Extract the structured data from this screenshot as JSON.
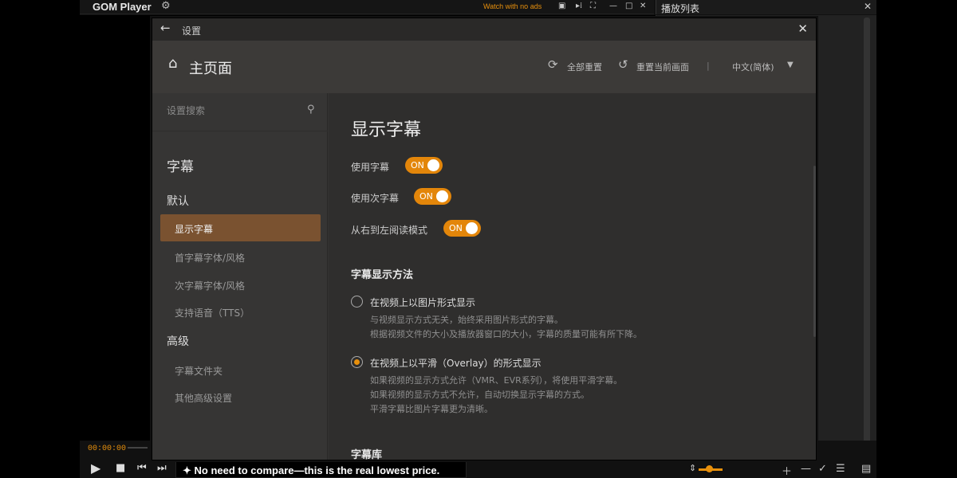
{
  "player": {
    "logo": "GOM Player",
    "ads_text": "Watch with no ads",
    "playlist_title": "播放列表",
    "time": "00:00:00",
    "ad_banner": "No need to compare—this is the real lowest price.",
    "volume_level": 0.3
  },
  "dialog": {
    "title": "设置",
    "home_title": "主页面",
    "reset_all": "全部重置",
    "reset_current": "重置当前画面",
    "separator": "|",
    "language": "中文(简体)"
  },
  "sidebar": {
    "search_placeholder": "设置搜索",
    "section_title": "字幕",
    "group_default": "默认",
    "items_default": [
      {
        "label": "显示字幕",
        "active": true
      },
      {
        "label": "首字幕字体/风格"
      },
      {
        "label": "次字幕字体/风格"
      },
      {
        "label": "支持语音（TTS）"
      }
    ],
    "group_advanced": "高级",
    "items_advanced": [
      {
        "label": "字幕文件夹"
      },
      {
        "label": "其他高级设置"
      }
    ]
  },
  "main": {
    "heading": "显示字幕",
    "toggles": [
      {
        "label": "使用字幕",
        "state": "ON"
      },
      {
        "label": "使用次字幕",
        "state": "ON"
      },
      {
        "label": "从右到左阅读模式",
        "state": "ON"
      }
    ],
    "method_title": "字幕显示方法",
    "option1": {
      "label": "在视频上以图片形式显示",
      "desc1": "与视频显示方式无关，始终采用图片形式的字幕。",
      "desc2": "根据视频文件的大小及播放器窗口的大小，字幕的质量可能有所下降。",
      "selected": false
    },
    "option2": {
      "label": "在视频上以平滑（Overlay）的形式显示",
      "desc1": "如果视频的显示方式允许（VMR、EVR系列），将使用平滑字幕。",
      "desc2": "如果视频的显示方式不允许，自动切换显示字幕的方式。",
      "desc3": "平滑字幕比图片字幕更为清晰。",
      "selected": true
    },
    "library_title": "字幕库"
  }
}
